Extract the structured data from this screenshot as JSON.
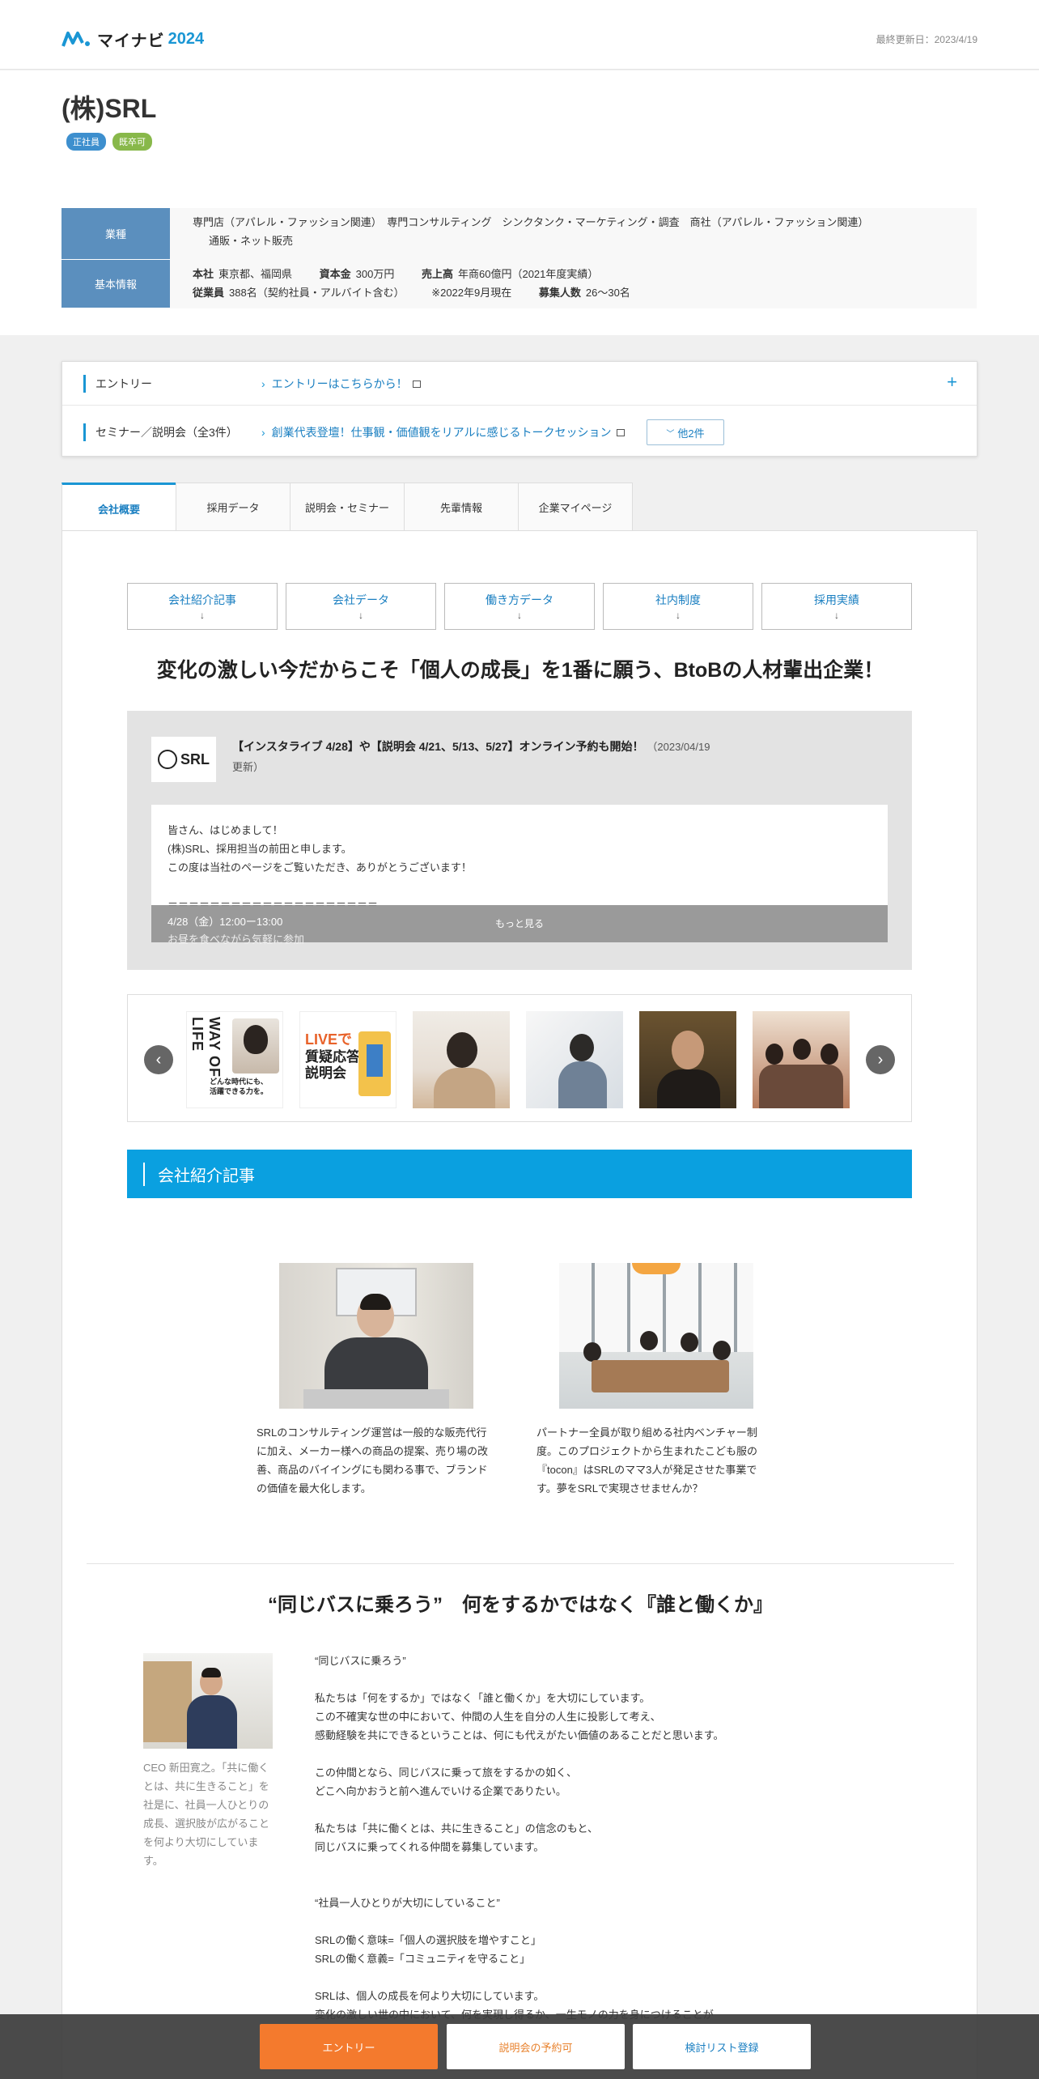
{
  "header": {
    "logo_text": "マイナビ",
    "logo_year": "2024",
    "updated": "最終更新日：2023/4/19"
  },
  "company": {
    "name": "(株)SRL",
    "badges": [
      "正社員",
      "既卒可"
    ],
    "industry_label": "業種",
    "industry_line1": "専門店（アパレル・ファッション関連）　専門コンサルティング　シンクタンク・マーケティング・調査　商社（アパレル・ファッション関連）",
    "industry_line2": "通販・ネット販売",
    "basic_label": "基本情報",
    "basic": {
      "hq_label": "本社",
      "hq": "東京都、福岡県",
      "capital_label": "資本金",
      "capital": "300万円",
      "sales_label": "売上高",
      "sales": "年商60億円（2021年度実績）",
      "employees_label": "従業員",
      "employees": "388名（契約社員・アルバイト含む）",
      "note": "※2022年9月現在",
      "hiring_label": "募集人数",
      "hiring": "26～30名"
    }
  },
  "entry_panel": {
    "entry_label": "エントリー",
    "entry_link": "エントリーはこちらから！",
    "seminar_label": "セミナー／説明会（全3件）",
    "seminar_link": "創業代表登壇！仕事観・価値観をリアルに感じるトークセッション",
    "more_label": "他2件",
    "expand": "+"
  },
  "tabs": [
    "会社概要",
    "採用データ",
    "説明会・セミナー",
    "先輩情報",
    "企業マイページ"
  ],
  "anchor_nav": [
    "会社紹介記事",
    "会社データ",
    "働き方データ",
    "社内制度",
    "採用実績"
  ],
  "anchor_arrow": "↓",
  "catch_copy": "変化の激しい今だからこそ「個人の成長」を1番に願う、BtoBの人材輩出企業！",
  "blog": {
    "logo_text": "SRL",
    "title": "【インスタライブ 4/28】や【説明会 4/21、5/13、5/27】オンライン予約も開始！",
    "date": "（2023/04/19",
    "date2": "更新）",
    "lines": [
      "皆さん、はじめまして！",
      "(株)SRL、採用担当の前田と申します。",
      "この度は当社のページをご覧いただき、ありがとうございます！",
      "",
      "＝＝＝＝＝＝＝＝＝＝＝＝＝＝＝＝＝＝＝＝"
    ],
    "fade_line1": "4/28（金）12:00ー13:00",
    "fade_line2": "お昼を食べながら気軽に参加",
    "more": "もっと見る"
  },
  "carousel": {
    "prev": "‹",
    "next": "›",
    "img1_vertical": "WAY OF LIFE",
    "img1_caption1": "どんな時代にも、",
    "img1_caption2": "活躍できる力を。",
    "img2_live": "LIVEで",
    "img2_title1": "質疑応答",
    "img2_title2": "説明会"
  },
  "section_title": "会社紹介記事",
  "articles": [
    {
      "text": "SRLのコンサルティング運営は一般的な販売代行に加え、メーカー様への商品の提案、売り場の改善、商品のバイイングにも関わる事で、ブランドの価値を最大化します。"
    },
    {
      "text": "パートナー全員が取り組める社内ベンチャー制度。このプロジェクトから生まれたこども服の『tocon』はSRLのママ3人が発足させた事業です。夢をSRLで実現させませんか？"
    }
  ],
  "catch_copy2": "“同じバスに乗ろう”　何をするかではなく『誰と働くか』",
  "ceo_caption": "CEO 新田寛之。「共に働くとは、共に生きること」を社是に、社員一人ひとりの成長、選択肢が広がることを何より大切にしています。",
  "ceo_text": [
    "“同じバスに乗ろう”",
    "",
    "私たちは「何をするか」ではなく「誰と働くか」を大切にしています。",
    "この不確実な世の中において、仲間の人生を自分の人生に投影して考え、",
    "感動経験を共にできるということは、何にも代えがたい価値のあることだと思います。",
    "",
    "この仲間となら、同じバスに乗って旅をするかの如く、",
    "どこへ向かおうと前へ進んでいける企業でありたい。",
    "",
    "私たちは「共に働くとは、共に生きること」の信念のもと、",
    "同じバスに乗ってくれる仲間を募集しています。",
    "",
    "",
    "“社員一人ひとりが大切にしていること”",
    "",
    "SRLの働く意味=「個人の選択肢を増やすこと」",
    "SRLの働く意義=「コミュニティを守ること」",
    "",
    "SRLは、個人の成長を何より大切にしています。",
    "変化の激しい世の中において、何を実現し得るか、一生モノの力を身につけることが"
  ],
  "bottom_bar": {
    "entry": "エントリー",
    "seminar": "説明会の予約可",
    "list": "検討リスト登録"
  },
  "colors": {
    "accent": "#0aa0e0",
    "entry_orange": "#f47a2d",
    "info_head": "#5b8fbe"
  }
}
